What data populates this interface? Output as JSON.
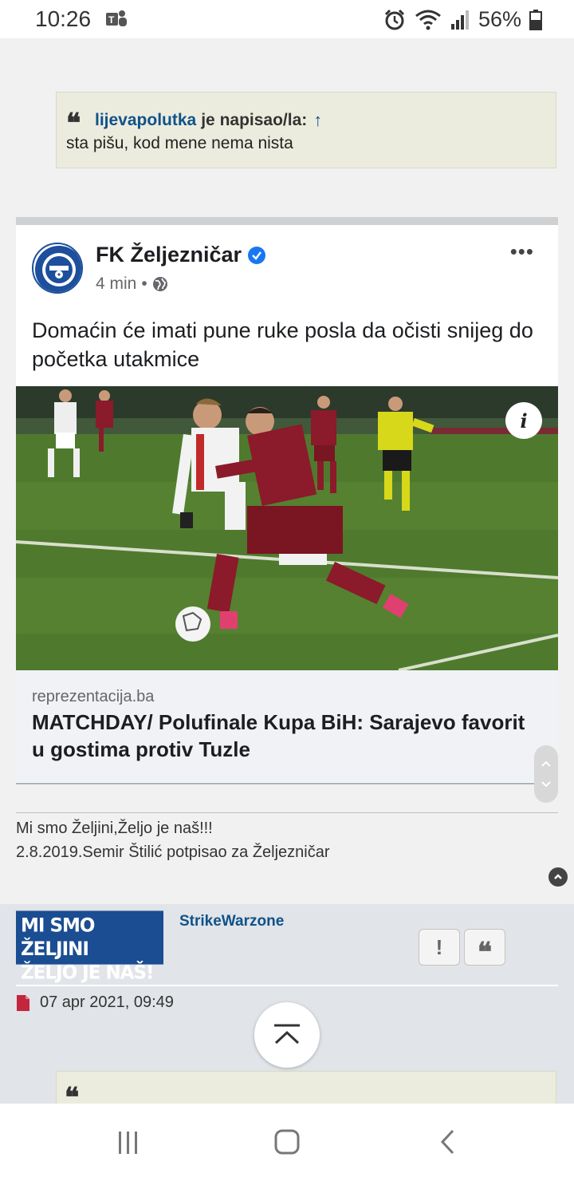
{
  "status_bar": {
    "time": "10:26",
    "battery": "56%",
    "icons": [
      "teams-icon",
      "alarm-icon",
      "wifi-icon",
      "signal-icon",
      "battery-icon"
    ]
  },
  "quote": {
    "author": "lijevapolutka",
    "says": "je napisao/la:",
    "arrow": "↑",
    "text": "sta pišu, kod mene nema nista"
  },
  "embed": {
    "page_name": "FK Željezničar",
    "time_ago": "4 min",
    "dot": "•",
    "more": "•••",
    "post_text": "Domaćin će imati pune ruke posla da očisti snijeg do početka utakmice",
    "info_label": "i",
    "link_domain": "reprezentacija.ba",
    "link_title": "MATCHDAY/ Polufinale Kupa BiH: Sarajevo favorit u gostima protiv Tuzle",
    "logo_text": [
      "FUDBALSKI KLUB",
      "ŽELJEZNIČAR",
      "FOOTBALL CLUB",
      "SARAJEVO"
    ]
  },
  "signature": {
    "line1": "Mi smo Željini,Željo je naš!!!",
    "line2": "2.8.2019.Semir Štilić potpisao za Željezničar"
  },
  "post2": {
    "avatar_text_1": "MI SMO ŽELJINI",
    "avatar_text_2": "ŽELJO JE NAŠ!",
    "author": "StrikeWarzone",
    "report_label": "!",
    "quote_label": "❝",
    "date": "07 apr 2021, 09:49"
  },
  "colors": {
    "link_blue": "#105289",
    "quote_bg": "#ececde",
    "post_bg": "#e1e4e8",
    "fb_blue": "#1877f2",
    "jersey_red": "#8b1a2a"
  }
}
